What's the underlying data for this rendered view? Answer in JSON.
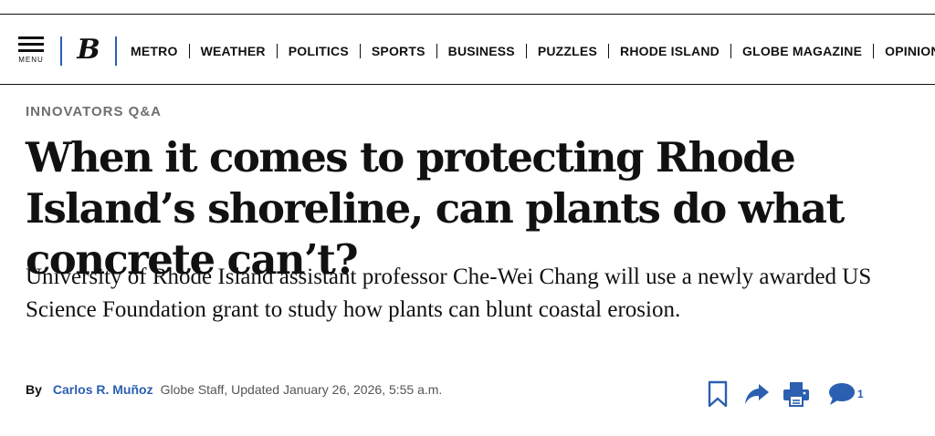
{
  "header": {
    "menu_label": "MENU",
    "logo_text": "B",
    "nav": [
      "METRO",
      "WEATHER",
      "POLITICS",
      "SPORTS",
      "BUSINESS",
      "PUZZLES",
      "RHODE ISLAND",
      "GLOBE MAGAZINE",
      "OPINION"
    ]
  },
  "article": {
    "kicker": "INNOVATORS Q&A",
    "headline": "When it comes to protecting Rhode Island’s shoreline, can plants do what concrete can’t?",
    "dek": "University of Rhode Island assistant professor Che-Wei Chang will use a newly awarded US Science Foundation grant to study how plants can blunt coastal erosion.",
    "byline_prefix": "By",
    "author": "Carlos R. Muñoz",
    "byline_meta": "Globe Staff, Updated January 26, 2026, 5:55 a.m."
  },
  "tools": {
    "comment_count": "1",
    "icons": [
      "bookmark-icon",
      "share-icon",
      "print-icon",
      "comment-icon"
    ]
  },
  "colors": {
    "accent": "#2b5fb0",
    "text": "#111111",
    "muted": "#6f6f6f"
  }
}
